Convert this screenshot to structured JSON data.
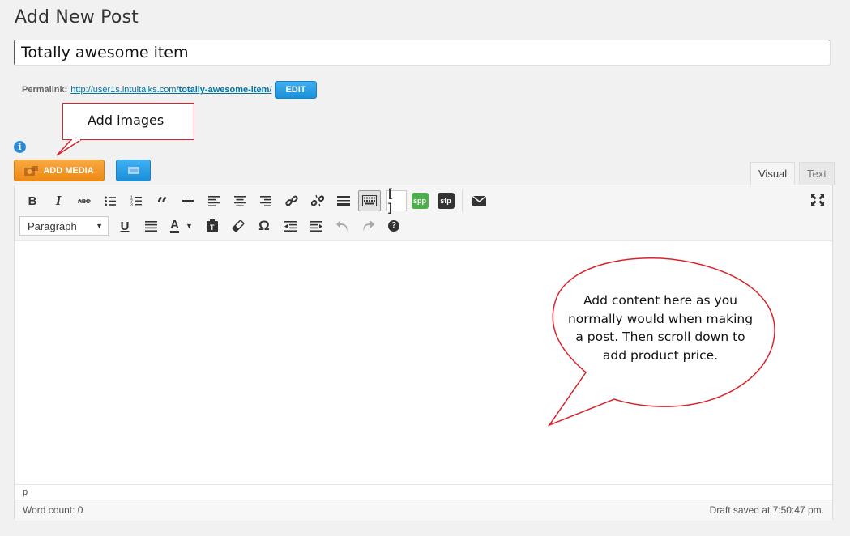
{
  "page": {
    "title": "Add New Post"
  },
  "post": {
    "title_value": "Totally awesome item"
  },
  "permalink": {
    "label": "Permalink:",
    "url_base": "http://user1s.intuitalks.com/",
    "url_slug": "totally-awesome-item",
    "url_end": "/",
    "edit_label": "EDIT"
  },
  "annotations": {
    "add_images": "Add images",
    "content_lines": [
      "Add content here as you",
      "normally would when making",
      "a post. Then scroll down to",
      "add product price."
    ]
  },
  "media": {
    "add_media_label": "ADD MEDIA"
  },
  "editor_tabs": {
    "visual": "Visual",
    "text": "Text"
  },
  "toolbar": {
    "format_select": "Paragraph",
    "spp_label": "spp",
    "stp_label": "stp",
    "omega": "Ω"
  },
  "editor": {
    "path": "p",
    "word_count": "Word count: 0",
    "draft_saved": "Draft saved at 7:50:47 pm."
  },
  "colors": {
    "accent_blue": "#2ea2e8",
    "media_orange": "#f0901a",
    "callout_red": "#d9232a",
    "spp_green": "#4cae4c",
    "stp_dark": "#333333"
  }
}
